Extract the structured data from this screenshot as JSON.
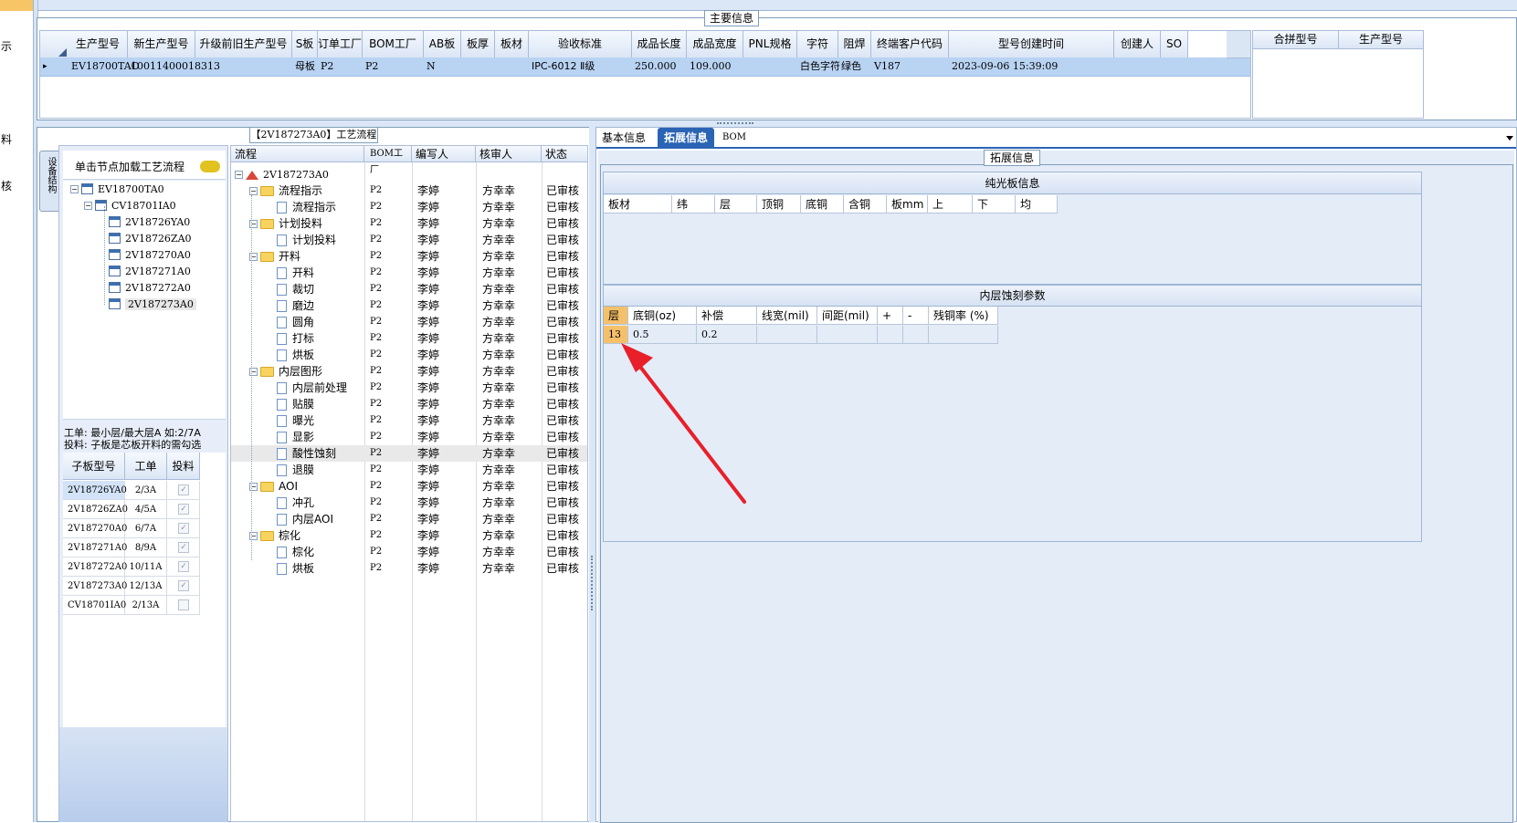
{
  "left_nav": {
    "chars": [
      "示",
      "料",
      "核"
    ]
  },
  "main_info": {
    "title": "主要信息",
    "columns": [
      "生产型号",
      "新生产型号",
      "升级前旧生产型号",
      "S板",
      "订单工厂",
      "BOM工厂",
      "AB板",
      "板厚",
      "板材",
      "验收标准",
      "成品长度",
      "成品宽度",
      "PNL规格",
      "字符",
      "阻焊",
      "终端客户代码",
      "型号创建时间",
      "创建人",
      "SO"
    ],
    "row": {
      "arrow": "▸",
      "生产型号": "EV18700TAO",
      "新生产型号": "10011400018313",
      "S板": "母板",
      "订单工厂": "P2",
      "BOM工厂": "P2",
      "AB板": "N",
      "验收标准": "IPC-6012 Ⅱ级",
      "成品长度": "250.000",
      "成品宽度": "109.000",
      "字符": "白色字符",
      "阻焊": "绿色",
      "终端客户代码": "V187",
      "型号创建时间": "2023-09-06 15:39:09"
    },
    "merge_cols": [
      "合拼型号",
      "生产型号"
    ]
  },
  "process": {
    "title": "【2V187273A0】工艺流程",
    "side_tab": "设备结构",
    "hint": "单击节点加载工艺流程",
    "tree": [
      {
        "label": "EV18700TA0"
      },
      {
        "label": "CV18701IA0"
      },
      {
        "label": "2V18726YA0"
      },
      {
        "label": "2V18726ZA0"
      },
      {
        "label": "2V187270A0"
      },
      {
        "label": "2V187271A0"
      },
      {
        "label": "2V187272A0"
      },
      {
        "label": "2V187273A0"
      }
    ],
    "note1": "工单: 最小层/最大层A 如:2/7A",
    "note2": "投料: 子板是芯板开料的需勾选",
    "sub_columns": [
      "子板型号",
      "工单",
      "投料"
    ],
    "sub_rows": [
      {
        "model": "2V18726YA0",
        "order": "2/3A",
        "checked": "✓"
      },
      {
        "model": "2V18726ZA0",
        "order": "4/5A",
        "checked": "✓"
      },
      {
        "model": "2V187270A0",
        "order": "6/7A",
        "checked": "✓"
      },
      {
        "model": "2V187271A0",
        "order": "8/9A",
        "checked": "✓"
      },
      {
        "model": "2V187272A0",
        "order": "10/11A",
        "checked": "✓"
      },
      {
        "model": "2V187273A0",
        "order": "12/13A",
        "checked": "✓"
      },
      {
        "model": "CV18701IA0",
        "order": "2/13A",
        "checked": ""
      }
    ],
    "flow_columns": [
      "流程",
      "BOM工厂",
      "编写人",
      "核审人",
      "状态"
    ],
    "flow_root": "2V187273A0",
    "flow_rows": [
      {
        "name": "流程指示",
        "level": 1,
        "type": "folder",
        "bom": "P2",
        "writer": "李婷",
        "auditor": "方幸幸",
        "status": "已审核"
      },
      {
        "name": "流程指示",
        "level": 2,
        "type": "doc",
        "bom": "P2",
        "writer": "李婷",
        "auditor": "方幸幸",
        "status": "已审核"
      },
      {
        "name": "计划投料",
        "level": 1,
        "type": "folder",
        "bom": "P2",
        "writer": "李婷",
        "auditor": "方幸幸",
        "status": "已审核"
      },
      {
        "name": "计划投料",
        "level": 2,
        "type": "doc",
        "bom": "P2",
        "writer": "李婷",
        "auditor": "方幸幸",
        "status": "已审核"
      },
      {
        "name": "开料",
        "level": 1,
        "type": "folder",
        "bom": "P2",
        "writer": "李婷",
        "auditor": "方幸幸",
        "status": "已审核"
      },
      {
        "name": "开料",
        "level": 2,
        "type": "doc",
        "bom": "P2",
        "writer": "李婷",
        "auditor": "方幸幸",
        "status": "已审核"
      },
      {
        "name": "裁切",
        "level": 2,
        "type": "doc",
        "bom": "P2",
        "writer": "李婷",
        "auditor": "方幸幸",
        "status": "已审核"
      },
      {
        "name": "磨边",
        "level": 2,
        "type": "doc",
        "bom": "P2",
        "writer": "李婷",
        "auditor": "方幸幸",
        "status": "已审核"
      },
      {
        "name": "圆角",
        "level": 2,
        "type": "doc",
        "bom": "P2",
        "writer": "李婷",
        "auditor": "方幸幸",
        "status": "已审核"
      },
      {
        "name": "打标",
        "level": 2,
        "type": "doc",
        "bom": "P2",
        "writer": "李婷",
        "auditor": "方幸幸",
        "status": "已审核"
      },
      {
        "name": "烘板",
        "level": 2,
        "type": "doc",
        "bom": "P2",
        "writer": "李婷",
        "auditor": "方幸幸",
        "status": "已审核"
      },
      {
        "name": "内层图形",
        "level": 1,
        "type": "folder",
        "bom": "P2",
        "writer": "李婷",
        "auditor": "方幸幸",
        "status": "已审核"
      },
      {
        "name": "内层前处理",
        "level": 2,
        "type": "doc",
        "bom": "P2",
        "writer": "李婷",
        "auditor": "方幸幸",
        "status": "已审核"
      },
      {
        "name": "贴膜",
        "level": 2,
        "type": "doc",
        "bom": "P2",
        "writer": "李婷",
        "auditor": "方幸幸",
        "status": "已审核"
      },
      {
        "name": "曝光",
        "level": 2,
        "type": "doc",
        "bom": "P2",
        "writer": "李婷",
        "auditor": "方幸幸",
        "status": "已审核"
      },
      {
        "name": "显影",
        "level": 2,
        "type": "doc",
        "bom": "P2",
        "writer": "李婷",
        "auditor": "方幸幸",
        "status": "已审核"
      },
      {
        "name": "酸性蚀刻",
        "level": 2,
        "type": "doc",
        "bom": "P2",
        "writer": "李婷",
        "auditor": "方幸幸",
        "status": "已审核",
        "selected": true
      },
      {
        "name": "退膜",
        "level": 2,
        "type": "doc",
        "bom": "P2",
        "writer": "李婷",
        "auditor": "方幸幸",
        "status": "已审核"
      },
      {
        "name": "AOI",
        "level": 1,
        "type": "folder",
        "bom": "P2",
        "writer": "李婷",
        "auditor": "方幸幸",
        "status": "已审核"
      },
      {
        "name": "冲孔",
        "level": 2,
        "type": "doc",
        "bom": "P2",
        "writer": "李婷",
        "auditor": "方幸幸",
        "status": "已审核"
      },
      {
        "name": "内层AOI",
        "level": 2,
        "type": "doc",
        "bom": "P2",
        "writer": "李婷",
        "auditor": "方幸幸",
        "status": "已审核"
      },
      {
        "name": "棕化",
        "level": 1,
        "type": "folder",
        "bom": "P2",
        "writer": "李婷",
        "auditor": "方幸幸",
        "status": "已审核"
      },
      {
        "name": "棕化",
        "level": 2,
        "type": "doc",
        "bom": "P2",
        "writer": "李婷",
        "auditor": "方幸幸",
        "status": "已审核"
      },
      {
        "name": "烘板",
        "level": 2,
        "type": "doc",
        "bom": "P2",
        "writer": "李婷",
        "auditor": "方幸幸",
        "status": "已审核"
      }
    ]
  },
  "right": {
    "tabs": [
      "基本信息",
      "拓展信息",
      "BOM"
    ],
    "active_tab": 1,
    "group_title": "拓展信息",
    "bare_title": "纯光板信息",
    "bare_cols": [
      "板材",
      "纬",
      "层",
      "顶铜",
      "底铜",
      "含铜",
      "板mm",
      "上",
      "下",
      "均"
    ],
    "etch_title": "内层蚀刻参数",
    "etch_cols": [
      "层",
      "底铜(oz)",
      "补偿",
      "线宽(mil)",
      "间距(mil)",
      "+",
      "-",
      "残铜率 (%)"
    ],
    "etch_row": [
      "13",
      "0.5",
      "0.2",
      "",
      "",
      "",
      "",
      ""
    ],
    "accent": "#f5c06a",
    "arrow_color": "#e8202a"
  }
}
